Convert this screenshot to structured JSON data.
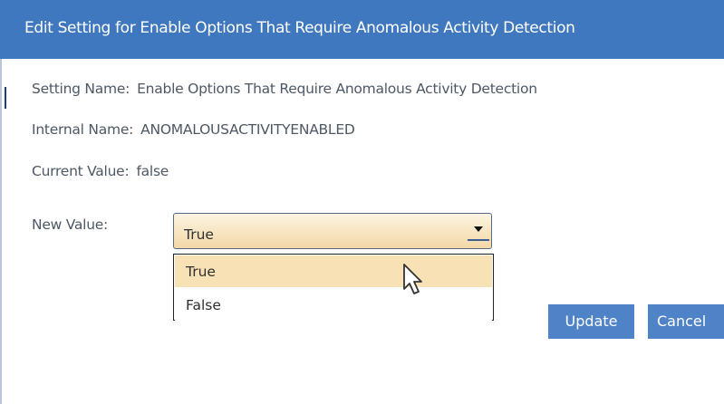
{
  "dialog": {
    "title": "Edit Setting for Enable Options That Require Anomalous Activity Detection"
  },
  "details": {
    "setting_name_label": "Setting Name:",
    "setting_name_value": "Enable Options That Require Anomalous Activity Detection",
    "internal_name_label": "Internal Name:",
    "internal_name_value": "ANOMALOUSACTIVITYENABLED",
    "current_value_label": "Current Value:",
    "current_value_value": "false"
  },
  "new_value": {
    "label": "New Value:",
    "selected": "True",
    "options": [
      "True",
      "False"
    ]
  },
  "buttons": {
    "update": "Update",
    "cancel": "Cancel"
  },
  "colors": {
    "header_blue": "#3f78bf",
    "button_blue": "#4f83c7",
    "highlight": "#f9e1b6"
  }
}
